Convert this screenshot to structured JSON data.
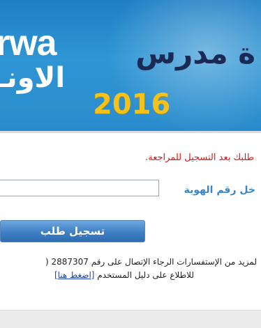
{
  "banner": {
    "logo_latin": "rwa",
    "logo_arabic": "الاونـ",
    "title": "ة مدرس",
    "year": "2016"
  },
  "form": {
    "notice": "طلبك بعد التسجيل للمراجعة.",
    "id_label": "خل رقم الهوية",
    "id_value": "",
    "register_button": "تسجيل طلب"
  },
  "help": {
    "contact": "لمزيد من الإستفسارات الرجاء الإتصال على رقم 2887307 (",
    "guide_text": "للاطلاع على دليل المستخدم",
    "guide_link": "[اضغط هنا]"
  },
  "colors": {
    "banner_blue": "#2a8ccc",
    "title_navy": "#1b2a55",
    "year_yellow": "#f4c21a",
    "notice_red": "#d21c1c",
    "label_blue": "#3a86c8",
    "link_blue": "#1a3fb0"
  }
}
